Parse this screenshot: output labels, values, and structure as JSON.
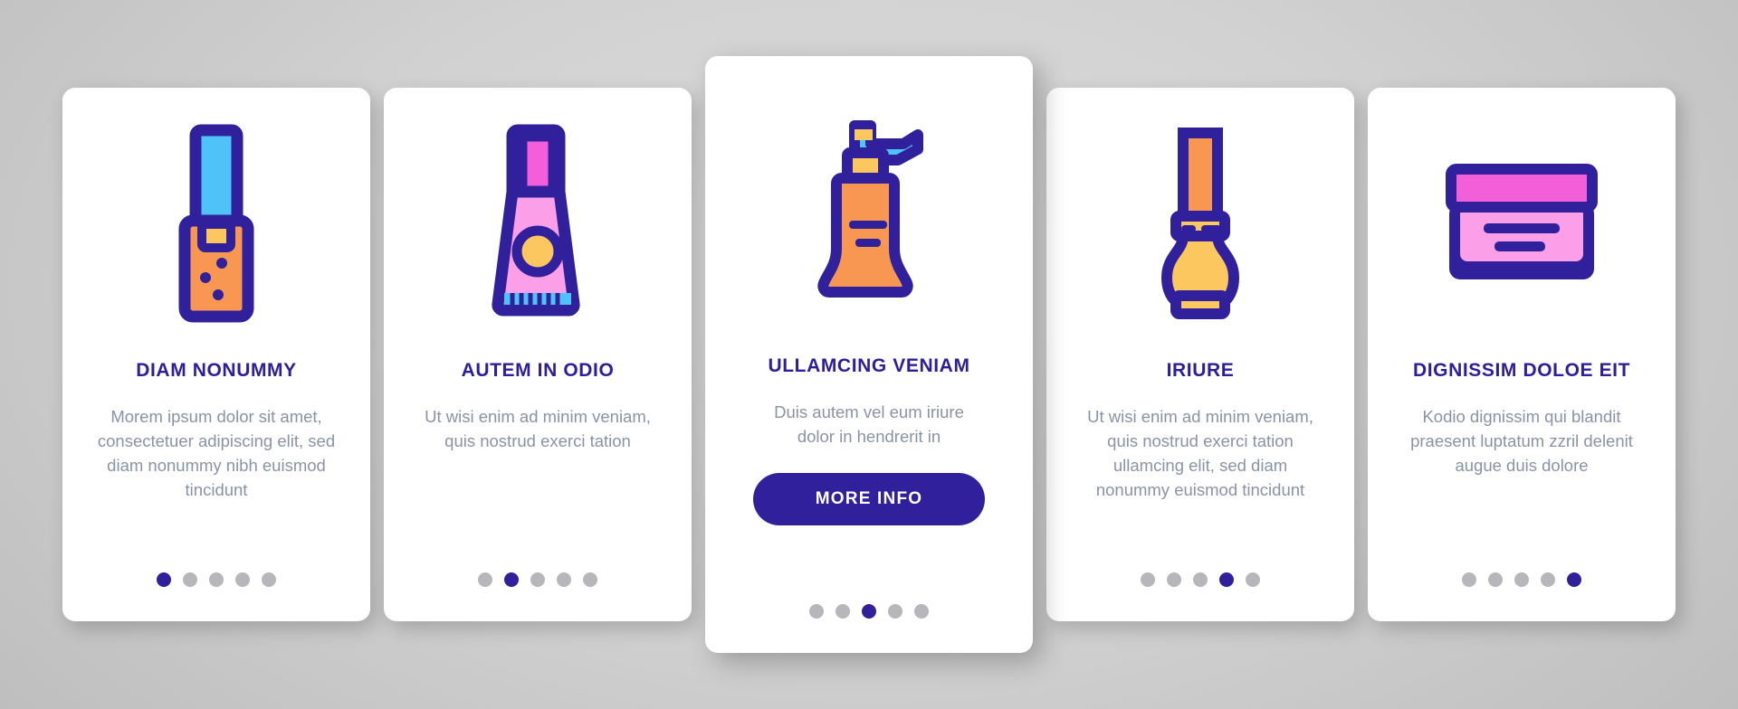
{
  "page": {
    "background_color": "#d2d2d2",
    "accent_color": "#31209b",
    "title_color": "#2d1e9b",
    "body_text_color": "#8a93a6",
    "dot_inactive_color": "#b7b7bb"
  },
  "cards": [
    {
      "icon_name": "lipstick-applicator-icon",
      "title": "DIAM NONUMMY",
      "description": "Morem ipsum dolor sit amet, consectetuer adipiscing elit, sed diam nonummy nibh euismod tincidunt",
      "featured": false,
      "dots": {
        "count": 5,
        "active_index": 0
      }
    },
    {
      "icon_name": "cosmetic-tube-icon",
      "title": "AUTEM IN ODIO",
      "description": "Ut wisi enim ad minim veniam, quis nostrud exerci tation",
      "featured": false,
      "dots": {
        "count": 5,
        "active_index": 1
      }
    },
    {
      "icon_name": "pump-dispenser-bottle-icon",
      "title": "ULLAMCING VENIAM",
      "description": "Duis autem vel eum iriure dolor in hendrerit in",
      "button_label": "MORE INFO",
      "featured": true,
      "dots": {
        "count": 5,
        "active_index": 2
      }
    },
    {
      "icon_name": "nail-polish-bottle-icon",
      "title": "IRIURE",
      "description": "Ut wisi enim ad minim veniam, quis nostrud exerci tation ullamcing elit, sed diam nonummy euismod tincidunt",
      "featured": false,
      "dots": {
        "count": 5,
        "active_index": 3
      }
    },
    {
      "icon_name": "cream-jar-icon",
      "title": "DIGNISSIM DOLOE EIT",
      "description": "Kodio dignissim qui blandit praesent luptatum zzril delenit augue duis dolore",
      "featured": false,
      "dots": {
        "count": 5,
        "active_index": 4
      }
    }
  ],
  "icon_colors": {
    "outline": "#31209b",
    "cyan": "#4fc3f7",
    "orange": "#f79752",
    "yellow": "#fbc75e",
    "magenta": "#f25fd8",
    "pink": "#fb9fe8"
  }
}
